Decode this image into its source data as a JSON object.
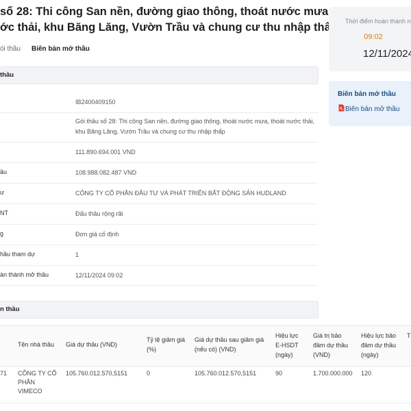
{
  "page": {
    "title_line1": "số 28: Thi công San nền, đường giao thông, thoát nước mưa,",
    "title_line2": "ớc thải, khu Băng Lăng, Vườn Trầu và chung cư thu nhập thấp"
  },
  "tabs": [
    {
      "label": "ói thầu"
    },
    {
      "label": "Biên bản mở thầu"
    }
  ],
  "info_section": {
    "title": "thầu",
    "rows": [
      {
        "label": "",
        "value": "IB2400409150"
      },
      {
        "label": "",
        "value": "Gói thầu số 28: Thi công San nền, đường giao thông, thoát nước mưa, thoát nước thải, khu Băng Lăng, Vườn Trầu và chung cư thu nhập thấp"
      },
      {
        "label": "",
        "value": "111.890.694.001 VND"
      },
      {
        "label": "ầu",
        "value": "108.988.082.487 VND"
      },
      {
        "label": "ư",
        "value": "CÔNG TY CỔ PHẦN ĐẦU TƯ VÀ PHÁT TRIỂN BẤT ĐỘNG SẢN HUDLAND"
      },
      {
        "label": "NT",
        "value": "Đấu thầu rộng rãi"
      },
      {
        "label": "g",
        "value": "Đơn giá cố định"
      },
      {
        "label": "hầu tham dự",
        "value": "1"
      },
      {
        "label": "àn thành mở thầu",
        "value": "12/11/2024 09:02"
      }
    ]
  },
  "bidder_section": {
    "title": "n thầu",
    "columns": [
      "Tên nhà thầu",
      "Giá dự thầu (VND)",
      "Tỷ lệ giảm giá (%)",
      "Giá dự thầu sau giảm giá (nếu có) (VND)",
      "Hiệu lực E-HSDT (ngày)",
      "Giá trị bảo đảm dự thầu (VND)",
      "Hiệu lực bảo đảm dự thầu (ngày)",
      "T"
    ],
    "rows": [
      {
        "code": "71",
        "name": "CÔNG TY CỔ PHẦN VIMECO",
        "bid_price": "105.760.012.570,5151",
        "discount": "0",
        "price_after_discount": "105.760.012.570,5151",
        "validity_days": "90",
        "guarantee_value": "1.700.000.000",
        "guarantee_validity": "120"
      }
    ]
  },
  "side_card": {
    "label": "Thời điểm hoàn thành m",
    "time": "09:02",
    "date": "12/11/2024"
  },
  "minutes_card": {
    "title": "Biên bản mở thầu",
    "link": "Biên bản mở thầu",
    "icon": "pdf-icon",
    "icon_color": "#e03a2f"
  },
  "colors": {
    "accent_orange": "#e07b00",
    "link_blue": "#1c4c80",
    "card_blue_bg": "#e9f1fb"
  }
}
